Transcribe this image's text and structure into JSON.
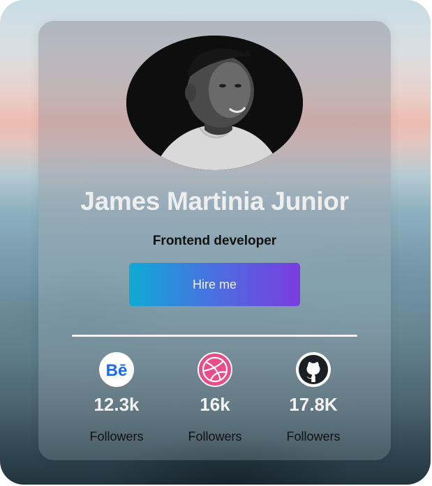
{
  "profile": {
    "name": "James Martinia Junior",
    "role": "Frontend developer",
    "hire_label": "Hire me"
  },
  "stats": [
    {
      "platform": "behance",
      "icon": "behance-icon",
      "count": "12.3k",
      "label": "Followers",
      "color": "#1769ff"
    },
    {
      "platform": "dribbble",
      "icon": "dribbble-icon",
      "count": "16k",
      "label": "Followers",
      "color": "#ea4c89"
    },
    {
      "platform": "github",
      "icon": "github-icon",
      "count": "17.8K",
      "label": "Followers",
      "color": "#1b1f23"
    }
  ],
  "colors": {
    "button_start": "#0eaad6",
    "button_end": "#7a3ce0"
  }
}
